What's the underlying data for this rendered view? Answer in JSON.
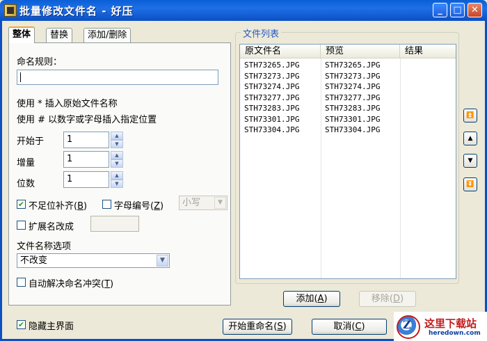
{
  "window": {
    "title": "批量修改文件名 - 好压",
    "min_glyph": "_",
    "max_glyph": "□",
    "close_glyph": "✕"
  },
  "tabs": [
    {
      "label": "整体",
      "active": true
    },
    {
      "label": "替换",
      "active": false
    },
    {
      "label": "添加/删除",
      "active": false
    }
  ],
  "left": {
    "rule_label": "命名规则：",
    "rule_value": "",
    "hint1": "使用 * 插入原始文件名称",
    "hint2": "使用 # 以数字或字母插入指定位置",
    "start_label": "开始于",
    "start_value": "1",
    "incr_label": "增量",
    "incr_value": "1",
    "digits_label": "位数",
    "digits_value": "1",
    "pad_label": "不足位补齐",
    "pad_key": "B",
    "pad_checked": true,
    "letter_label": "字母编号",
    "letter_key": "Z",
    "letter_checked": false,
    "case_value": "小写",
    "ext_label": "扩展名改成",
    "ext_checked": false,
    "options_label": "文件名称选项",
    "options_value": "不改变",
    "auto_label": "自动解决命名冲突",
    "auto_key": "T",
    "auto_checked": false
  },
  "filelist": {
    "group_label": "文件列表",
    "columns": [
      "原文件名",
      "预览",
      "结果"
    ],
    "rows": [
      {
        "orig": "STH73265.JPG",
        "preview": "STH73265.JPG",
        "result": ""
      },
      {
        "orig": "STH73273.JPG",
        "preview": "STH73273.JPG",
        "result": ""
      },
      {
        "orig": "STH73274.JPG",
        "preview": "STH73274.JPG",
        "result": ""
      },
      {
        "orig": "STH73277.JPG",
        "preview": "STH73277.JPG",
        "result": ""
      },
      {
        "orig": "STH73283.JPG",
        "preview": "STH73283.JPG",
        "result": ""
      },
      {
        "orig": "STH73301.JPG",
        "preview": "STH73301.JPG",
        "result": ""
      },
      {
        "orig": "STH73304.JPG",
        "preview": "STH73304.JPG",
        "result": ""
      }
    ],
    "add_label": "添加",
    "add_key": "A",
    "remove_label": "移除",
    "remove_key": "D"
  },
  "side_buttons": [
    "⏫",
    "▲",
    "▼",
    "⏬"
  ],
  "footer": {
    "hide_main_label": "隐藏主界面",
    "hide_main_checked": true,
    "start_label": "开始重命名",
    "start_key": "S",
    "cancel_label": "取消",
    "cancel_key": "C"
  },
  "watermark": {
    "brand_cn": "这里下载站",
    "brand_en": "heredown.com",
    "logo_letter": "Z"
  }
}
